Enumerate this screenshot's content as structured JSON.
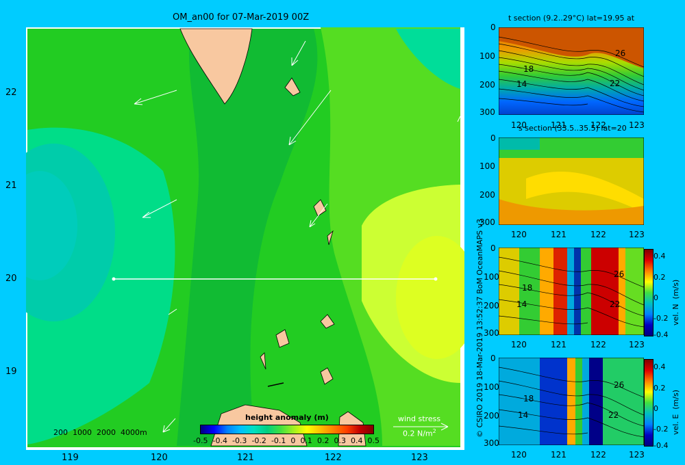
{
  "map": {
    "title": "OM_an00 for 07-Mar-2019 00Z",
    "lat_ticks": [
      "22",
      "21",
      "20",
      "19"
    ],
    "lon_ticks": [
      "119",
      "120",
      "121",
      "122",
      "123"
    ],
    "depth_legend": "200  1000  2000  4000m",
    "colorbar_title": "height anomaly  (m)",
    "colorbar_ticks": [
      "-0.5",
      "-0.4",
      "-0.3",
      "-0.2",
      "-0.1",
      "0",
      "0.1",
      "0.2",
      "0.3",
      "0.4",
      "0.5"
    ],
    "wind_label": "wind stress",
    "wind_scale": "0.2 N/m",
    "wind_scale_exp": "2",
    "section_lat": 20.0,
    "section_lon_range": [
      119.5,
      123.2
    ]
  },
  "panels": [
    {
      "id": "t-section",
      "title": "t section (9.2..29°C) lat=19.95 at",
      "depth_ticks": [
        "0",
        "100",
        "200",
        "300"
      ],
      "lon_ticks": [
        "120",
        "121",
        "122",
        "123"
      ],
      "contour_labels": [
        "26",
        "18",
        "14",
        "22"
      ]
    },
    {
      "id": "s-section",
      "title": "s section (33.5..35.5) lat=20",
      "depth_ticks": [
        "0",
        "100",
        "200",
        "300"
      ],
      "lon_ticks": [
        "120",
        "121",
        "122",
        "123"
      ]
    },
    {
      "id": "vn-section",
      "depth_ticks": [
        "0",
        "100",
        "200",
        "300"
      ],
      "lon_ticks": [
        "120",
        "121",
        "122",
        "123"
      ],
      "contour_labels": [
        "26",
        "18",
        "14",
        "22"
      ],
      "colorbar_ticks": [
        "0.4",
        "0.2",
        "0",
        "-0.2",
        "-0.4"
      ],
      "colorbar_label": "vel. N  (m/s)"
    },
    {
      "id": "ve-section",
      "depth_ticks": [
        "0",
        "100",
        "200",
        "300"
      ],
      "lon_ticks": [
        "120",
        "121",
        "122",
        "123"
      ],
      "contour_labels": [
        "26",
        "18",
        "14",
        "22"
      ],
      "colorbar_ticks": [
        "0.4",
        "0.2",
        "0",
        "-0.2",
        "-0.4"
      ],
      "colorbar_label": "vel. E  (m/s)"
    }
  ],
  "side_credit": "© CSIRO 2019  18-Mar-2019 13:52:37 BoM OceanMAPS v3",
  "colors": {
    "background": "#00ccff",
    "land": "#f8c8a0",
    "sea_main": "#22cc22",
    "sea_warm": "#ccff33",
    "sea_cool": "#00dd99"
  }
}
